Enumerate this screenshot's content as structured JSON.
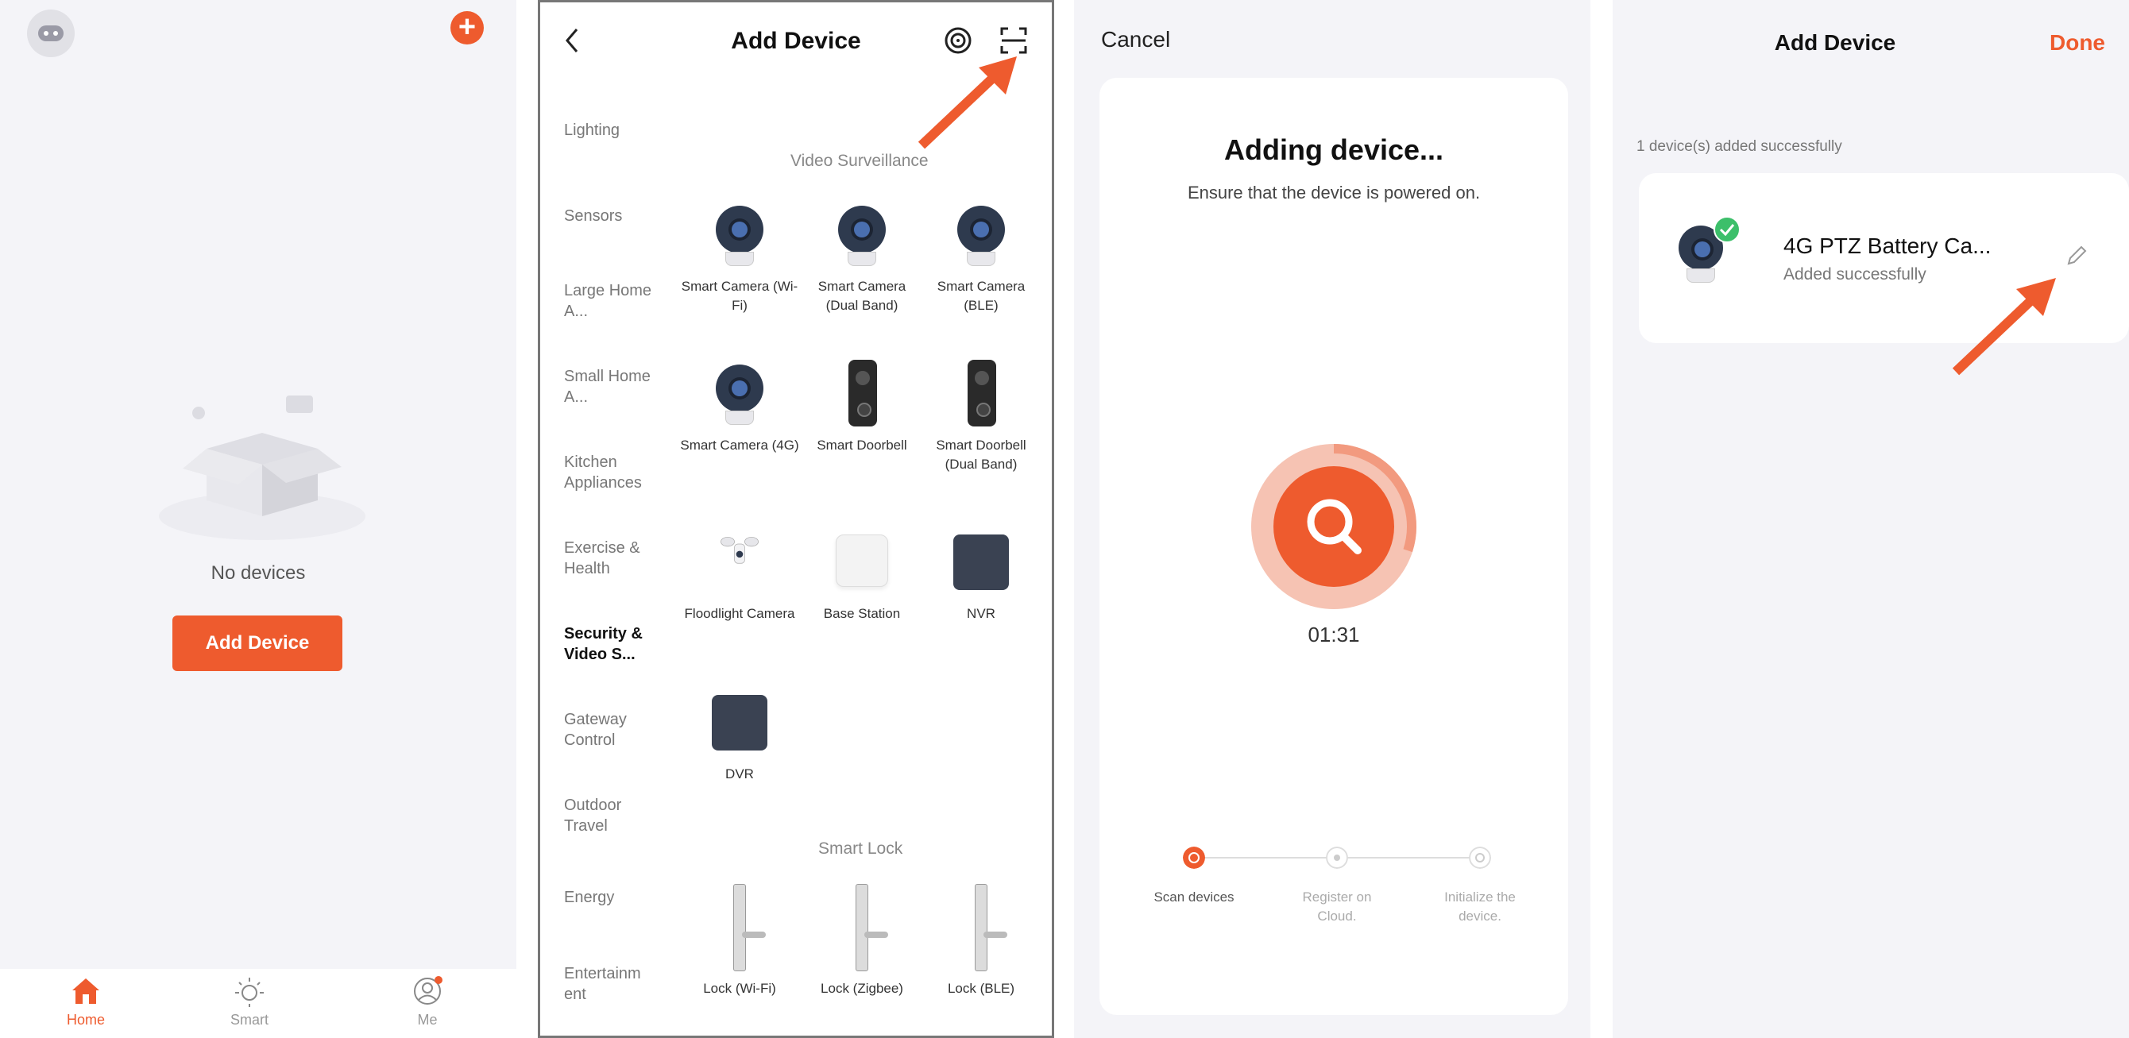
{
  "colors": {
    "accent": "#ee5b2e",
    "success": "#3cbf6a",
    "page_bg": "#f4f4f8"
  },
  "home": {
    "empty_text": "No devices",
    "add_button": "Add Device",
    "icons": {
      "avatar": "robot-avatar-icon",
      "add": "plus-icon",
      "empty": "empty-box-icon"
    },
    "tabs": [
      {
        "label": "Home",
        "icon": "home-icon",
        "active": true
      },
      {
        "label": "Smart",
        "icon": "sun-icon",
        "active": false
      },
      {
        "label": "Me",
        "icon": "person-icon",
        "active": false
      }
    ]
  },
  "add_device": {
    "title": "Add Device",
    "icons": {
      "back": "chevron-left-icon",
      "scan_qr": "scan-icon",
      "scan_target": "target-icon",
      "pointer": "red-arrow-icon"
    },
    "categories": [
      "Lighting",
      "Sensors",
      "Large Home A...",
      "Small Home A...",
      "Kitchen Appliances",
      "Exercise & Health",
      "Security & Video S...",
      "Gateway Control",
      "Outdoor Travel",
      "Energy",
      "Entertainm ent"
    ],
    "active_category": "Security & Video S...",
    "video_section": "Video Surveillance",
    "lock_section": "Smart Lock",
    "devices": [
      {
        "label": "Smart Camera (Wi-Fi)",
        "icon": "camera-icon"
      },
      {
        "label": "Smart Camera (Dual Band)",
        "icon": "camera-icon"
      },
      {
        "label": "Smart Camera (BLE)",
        "icon": "camera-icon"
      },
      {
        "label": "Smart Camera (4G)",
        "icon": "camera-icon"
      },
      {
        "label": "Smart Doorbell",
        "icon": "doorbell-icon"
      },
      {
        "label": "Smart Doorbell (Dual Band)",
        "icon": "doorbell-icon"
      },
      {
        "label": "Floodlight Camera",
        "icon": "floodlight-icon"
      },
      {
        "label": "Base Station",
        "icon": "base-station-icon"
      },
      {
        "label": "NVR",
        "icon": "nvr-icon"
      },
      {
        "label": "DVR",
        "icon": "dvr-icon"
      }
    ],
    "locks": [
      {
        "label": "Lock (Wi-Fi)",
        "icon": "lock-icon"
      },
      {
        "label": "Lock (Zigbee)",
        "icon": "lock-icon"
      },
      {
        "label": "Lock (BLE)",
        "icon": "lock-icon"
      }
    ]
  },
  "adding": {
    "cancel": "Cancel",
    "title": "Adding device...",
    "subtitle": "Ensure that the device is powered on.",
    "timer": "01:31",
    "progress_fraction": 0.3,
    "icons": {
      "search": "search-icon"
    },
    "steps": [
      {
        "label": "Scan devices",
        "icon": "scan-step-icon",
        "active": true
      },
      {
        "label": "Register on Cloud.",
        "icon": "cloud-step-icon",
        "active": false
      },
      {
        "label": "Initialize the device.",
        "icon": "init-step-icon",
        "active": false
      }
    ]
  },
  "result": {
    "title": "Add Device",
    "done": "Done",
    "summary": "1 device(s) added successfully",
    "device_name": "4G PTZ Battery Ca...",
    "device_status": "Added successfully",
    "icons": {
      "device": "camera-icon",
      "success": "check-badge-icon",
      "edit": "pencil-icon",
      "pointer": "red-arrow-icon"
    }
  }
}
